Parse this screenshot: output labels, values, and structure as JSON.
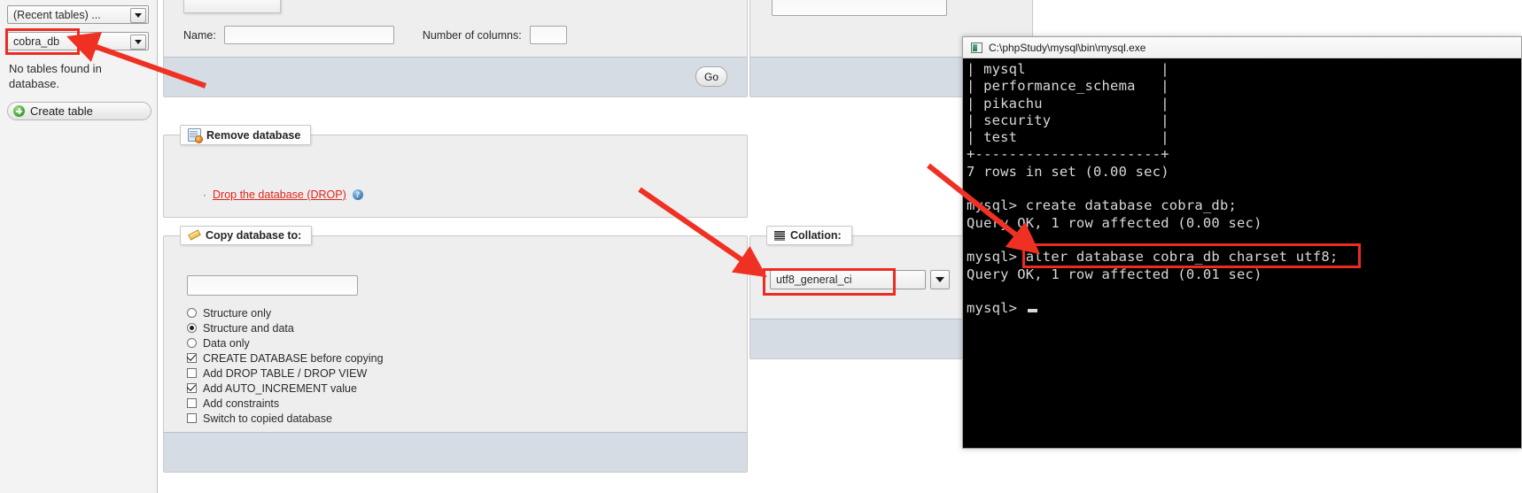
{
  "sidebar": {
    "recent_tables_select": "(Recent tables) ...",
    "database_select": "cobra_db",
    "no_tables_message": "No tables found in database.",
    "create_table_label": "Create table"
  },
  "create_table_panel": {
    "name_label": "Name:",
    "name_value": "",
    "columns_label": "Number of columns:",
    "columns_value": "",
    "go_label": "Go"
  },
  "remove_database_panel": {
    "legend": "Remove database",
    "bullet": "·",
    "drop_link": "Drop the database (DROP)",
    "help_glyph": "?"
  },
  "copy_database_panel": {
    "legend": "Copy database to:",
    "target_value": "",
    "options": [
      {
        "type": "radio",
        "label": "Structure only",
        "checked": false
      },
      {
        "type": "radio",
        "label": "Structure and data",
        "checked": true
      },
      {
        "type": "radio",
        "label": "Data only",
        "checked": false
      },
      {
        "type": "checkbox",
        "label": "CREATE DATABASE before copying",
        "checked": true
      },
      {
        "type": "checkbox",
        "label": "Add DROP TABLE / DROP VIEW",
        "checked": false
      },
      {
        "type": "checkbox",
        "label": "Add AUTO_INCREMENT value",
        "checked": true
      },
      {
        "type": "checkbox",
        "label": "Add constraints",
        "checked": false
      },
      {
        "type": "checkbox",
        "label": "Switch to copied database",
        "checked": false
      }
    ]
  },
  "collation_panel": {
    "legend": "Collation:",
    "selected": "utf8_general_ci"
  },
  "terminal": {
    "title": "C:\\phpStudy\\mysql\\bin\\mysql.exe",
    "lines": [
      "| mysql                |",
      "| performance_schema   |",
      "| pikachu              |",
      "| security             |",
      "| test                 |",
      "+----------------------+",
      "7 rows in set (0.00 sec)",
      "",
      "mysql> create database cobra_db;",
      "Query OK, 1 row affected (0.00 sec)",
      "",
      "mysql> alter database cobra_db charset utf8;",
      "Query OK, 1 row affected (0.01 sec)",
      "",
      "mysql>"
    ],
    "prompt": "mysql>"
  },
  "annotations": {
    "highlight_color": "#ee2b22",
    "arrow_color": "#ef3124",
    "highlights": [
      "database-select",
      "collation-select",
      "alter-database-command"
    ]
  }
}
